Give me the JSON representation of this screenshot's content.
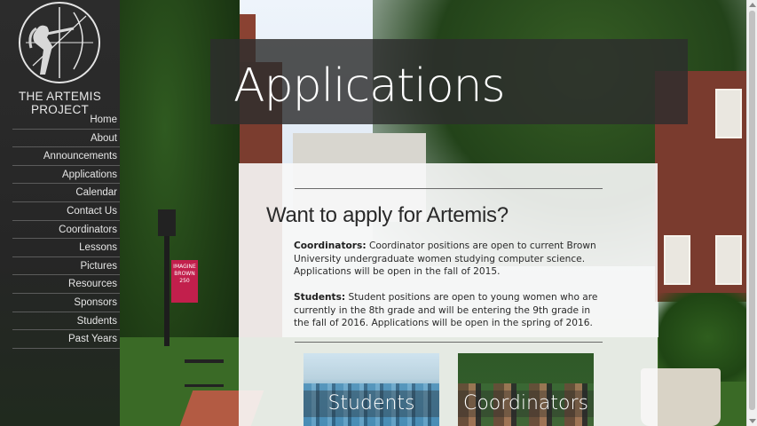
{
  "site": {
    "logo_text": "THE ARTEMIS PROJECT",
    "logo_icon": "archer-icon"
  },
  "nav": {
    "items": [
      {
        "label": "Home"
      },
      {
        "label": "About"
      },
      {
        "label": "Announcements"
      },
      {
        "label": "Applications"
      },
      {
        "label": "Calendar"
      },
      {
        "label": "Contact Us"
      },
      {
        "label": "Coordinators"
      },
      {
        "label": "Lessons"
      },
      {
        "label": "Pictures"
      },
      {
        "label": "Resources"
      },
      {
        "label": "Sponsors"
      },
      {
        "label": "Students"
      },
      {
        "label": "Past Years"
      }
    ]
  },
  "header": {
    "title": "Applications"
  },
  "content": {
    "heading": "Want to apply for Artemis?",
    "coordinators": {
      "label": "Coordinators:",
      "text": " Coordinator positions are open to current Brown University undergraduate women studying computer science. Applications will be open in the fall of 2015."
    },
    "students": {
      "label": "Students:",
      "text": " Student positions are open to young women who are currently in the 8th grade and will be entering the 9th grade in the fall of 2016. Applications will be open in the spring of 2016."
    }
  },
  "tiles": {
    "students": "Students",
    "coordinators": "Coordinators"
  },
  "background": {
    "banner_text": "IMAGINE BROWN 250"
  },
  "colors": {
    "sidebar": "#2a2a2a",
    "header_band": "#2d2d2d",
    "panel": "#f8f8f8",
    "banner": "#c21f4c"
  }
}
